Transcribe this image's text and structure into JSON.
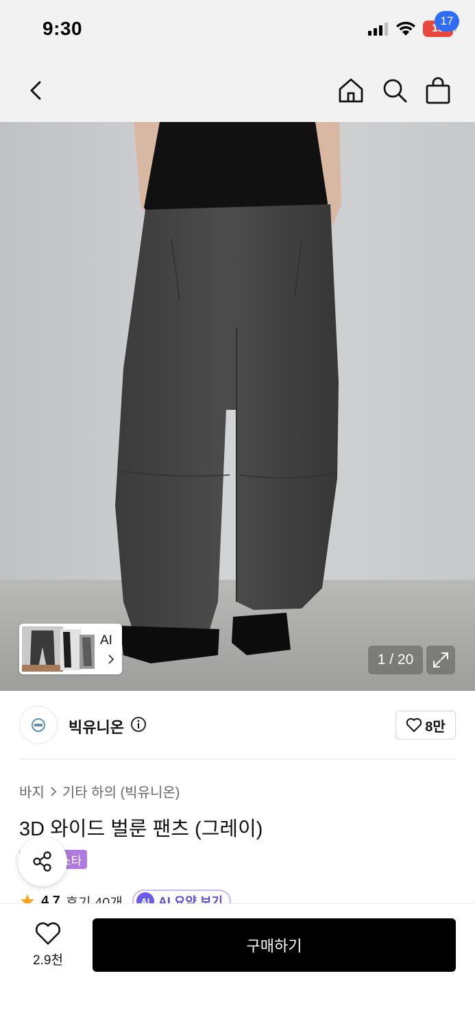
{
  "status_bar": {
    "time": "9:30",
    "battery": "13"
  },
  "nav": {
    "cart_count": "17"
  },
  "gallery": {
    "ai_label": "AI",
    "page_counter": "1 / 20"
  },
  "brand": {
    "name": "빅유니온",
    "likes": "8만"
  },
  "breadcrumb": {
    "category": "바지",
    "subcategory": "기타 하의 (빅유니온)"
  },
  "product": {
    "title": "3D 와이드 벌룬 팬츠 (그레이)",
    "tag": "스타",
    "rating": "4.7",
    "reviews": "후기 40개",
    "ai_summary_icon": "AI",
    "ai_summary": "AI 요약 보기"
  },
  "bottom": {
    "wish_count": "2.9천",
    "buy_label": "구매하기"
  },
  "colors": {
    "accent_blue": "#2f6df6",
    "tag_purple": "#b07ae0",
    "buy_black": "#000000",
    "battery_red": "#e9483f"
  },
  "icons": [
    "back-icon",
    "home-icon",
    "search-icon",
    "cart-icon",
    "expand-icon",
    "info-icon",
    "heart-icon",
    "share-icon",
    "star-icon",
    "chevron-right-icon",
    "signal-icon",
    "wifi-icon",
    "battery-icon"
  ]
}
